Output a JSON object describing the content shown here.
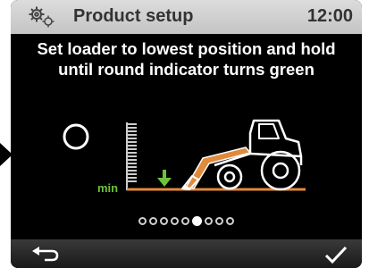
{
  "header": {
    "title": "Product setup",
    "time": "12:00",
    "icon": "gear-icon"
  },
  "instruction": {
    "line1": "Set loader to lowest position and hold",
    "line2": "until round indicator turns green"
  },
  "illustration": {
    "min_label": "min",
    "status_indicator_icon": "circle-outline-icon",
    "down_arrow_icon": "down-arrow-icon",
    "tractor_icon": "tractor-loader-icon",
    "scale_icon": "height-scale-icon"
  },
  "pager": {
    "total": 9,
    "active_index": 5
  },
  "footer": {
    "back_icon": "back-arrow-icon",
    "confirm_icon": "checkmark-icon"
  },
  "colors": {
    "background": "#000000",
    "header": "#d0d0d0",
    "min_label": "#6cc23a",
    "arrow": "#6cc23a",
    "ground": "#e08a3c",
    "loader_arm": "#e08a3c"
  }
}
